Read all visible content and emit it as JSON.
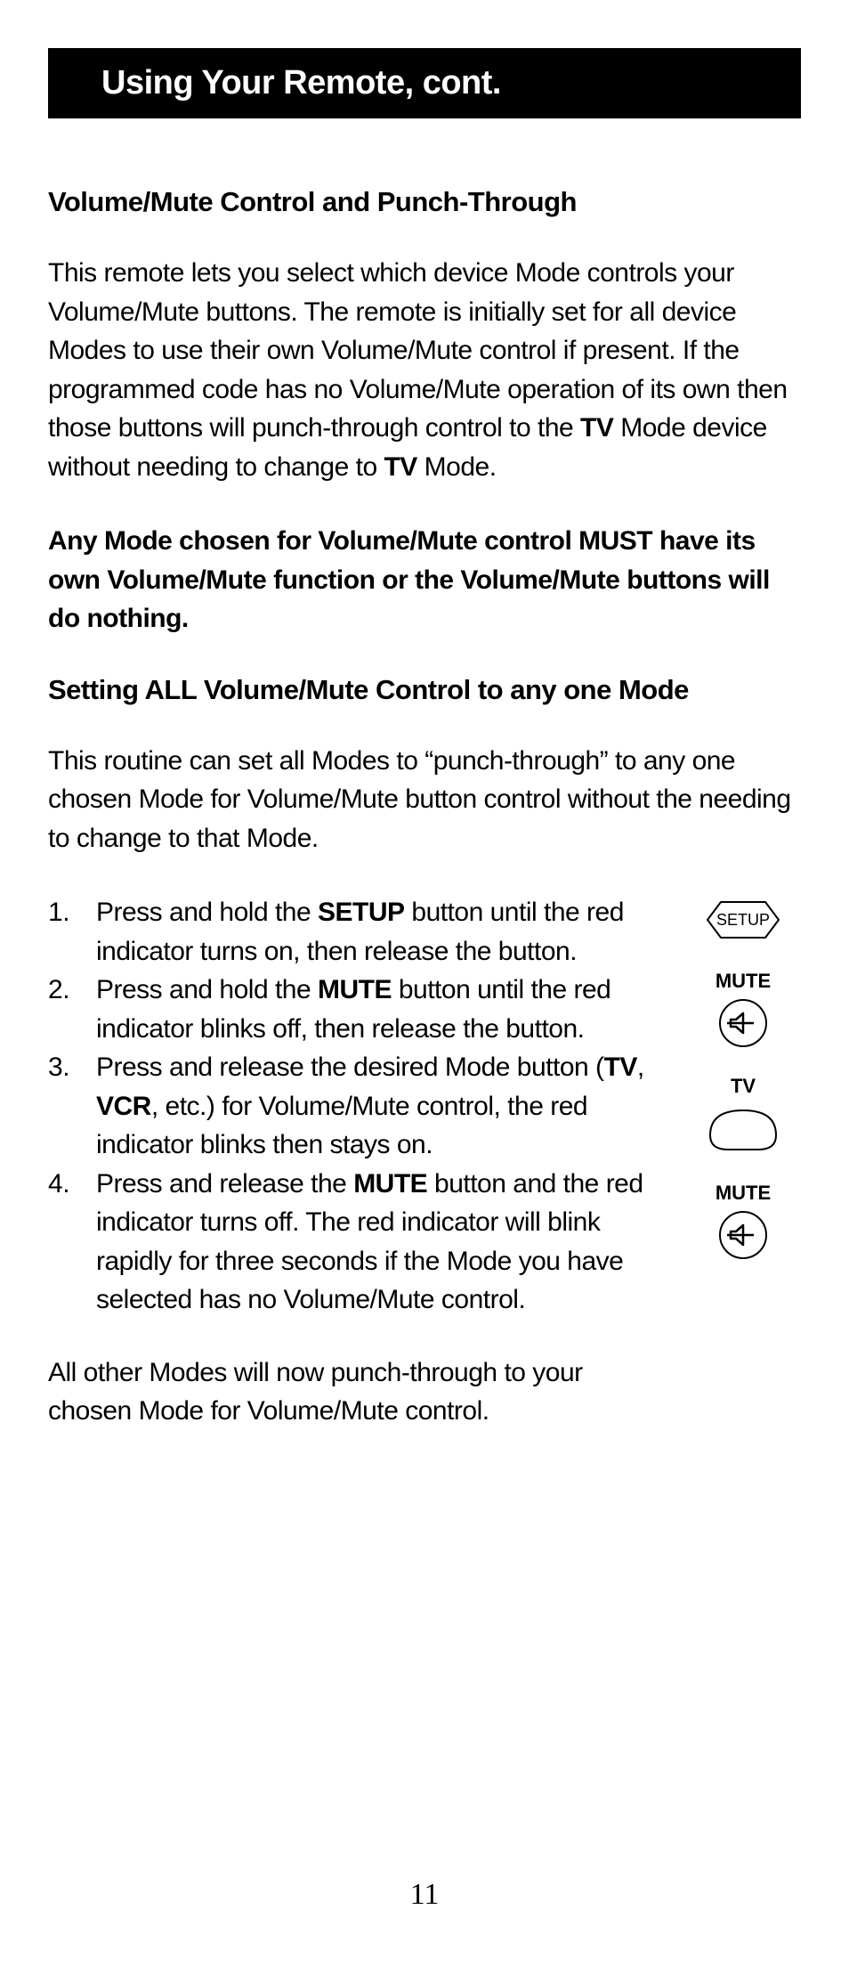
{
  "header": {
    "title": "Using Your Remote, cont."
  },
  "section1": {
    "title": "Volume/Mute Control and Punch-Through",
    "para1_a": "This remote lets you select which device Mode controls your Volume/Mute buttons. The remote is initially set for all device Modes to use their own Volume/Mute control if present. If the programmed code has no Volume/Mute operation of its own then those buttons will punch-through control to the ",
    "para1_b": "TV",
    "para1_c": " Mode device without needing to change to ",
    "para1_d": "TV",
    "para1_e": " Mode.",
    "para2": "Any Mode chosen for Volume/Mute control MUST have its own Volume/Mute function or the Volume/Mute buttons will do nothing."
  },
  "section2": {
    "title": "Setting ALL Volume/Mute Control to any one Mode",
    "intro": "This routine can set all Modes to “punch-through” to any one chosen Mode for Volume/Mute button control without the needing to change to that Mode.",
    "steps": {
      "s1_a": "Press and hold the ",
      "s1_b": "SETUP",
      "s1_c": " button until the red indicator turns on, then release the button.",
      "s2_a": "Press and hold the ",
      "s2_b": "MUTE",
      "s2_c": " button until the red indicator blinks off, then release the button.",
      "s3_a": "Press and release the desired Mode button (",
      "s3_b": "TV",
      "s3_c": ", ",
      "s3_d": "VCR",
      "s3_e": ", etc.) for Volume/Mute control, the red indicator blinks then stays on.",
      "s4_a": "Press and release the ",
      "s4_b": "MUTE",
      "s4_c": " button and the red indicator turns off. The red indicator will blink rapidly for three seconds if the Mode you have selected has no Volume/Mute control."
    },
    "closing": "All other Modes will now punch-through to your chosen Mode for Volume/Mute control."
  },
  "buttons": {
    "setup": "SETUP",
    "mute1": "MUTE",
    "tv": "TV",
    "mute2": "MUTE"
  },
  "page_number": "11"
}
